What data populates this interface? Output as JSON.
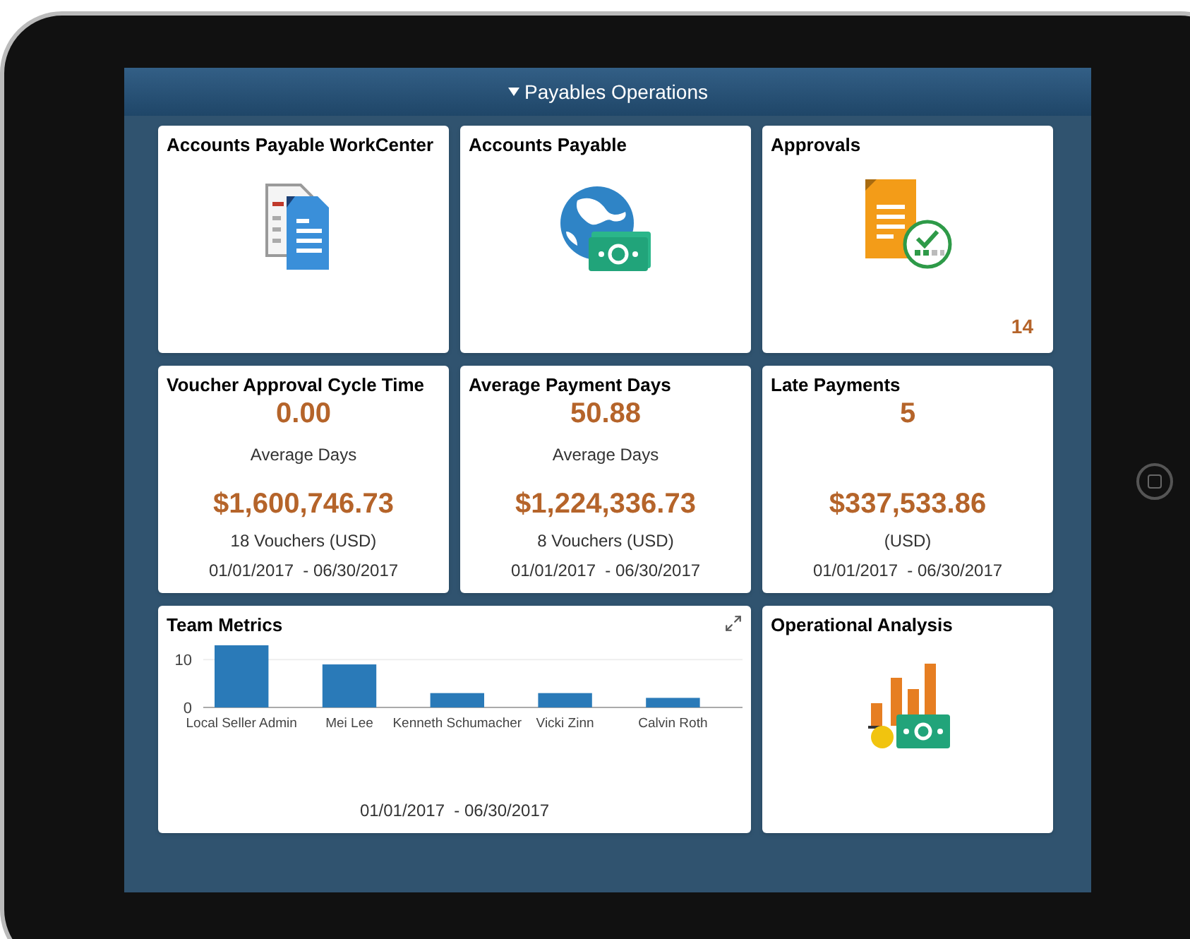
{
  "header": {
    "title": "Payables Operations",
    "expanded": true
  },
  "tiles": [
    {
      "kind": "icon",
      "title": "Accounts Payable WorkCenter"
    },
    {
      "kind": "icon",
      "title": "Accounts Payable"
    },
    {
      "kind": "icon",
      "title": "Approvals",
      "count": "14"
    },
    {
      "kind": "kpi",
      "title": "Voucher Approval Cycle Time",
      "value": "0.00",
      "value_label": "Average Days",
      "amount": "$1,600,746.73",
      "amount_label": "18 Vouchers (USD)",
      "date_range": "01/01/2017  - 06/30/2017"
    },
    {
      "kind": "kpi",
      "title": "Average Payment Days",
      "value": "50.88",
      "value_label": "Average Days",
      "amount": "$1,224,336.73",
      "amount_label": "8 Vouchers (USD)",
      "date_range": "01/01/2017  - 06/30/2017"
    },
    {
      "kind": "kpi",
      "title": "Late Payments",
      "value": "5",
      "amount": "$337,533.86",
      "amount_label": "(USD)",
      "date_range": "01/01/2017  - 06/30/2017"
    },
    {
      "kind": "chart",
      "title": "Team Metrics",
      "date_range": "01/01/2017  - 06/30/2017",
      "chart_data": {
        "type": "bar",
        "categories": [
          "Local Seller Admin",
          "Mei Lee",
          "Kenneth Schumacher",
          "Vicki Zinn",
          "Calvin Roth"
        ],
        "values": [
          13,
          9,
          3,
          3,
          2
        ],
        "ylim": [
          0,
          13
        ],
        "yticks": [
          0,
          10
        ]
      }
    },
    {
      "kind": "icon",
      "title": "Operational Analysis"
    }
  ]
}
